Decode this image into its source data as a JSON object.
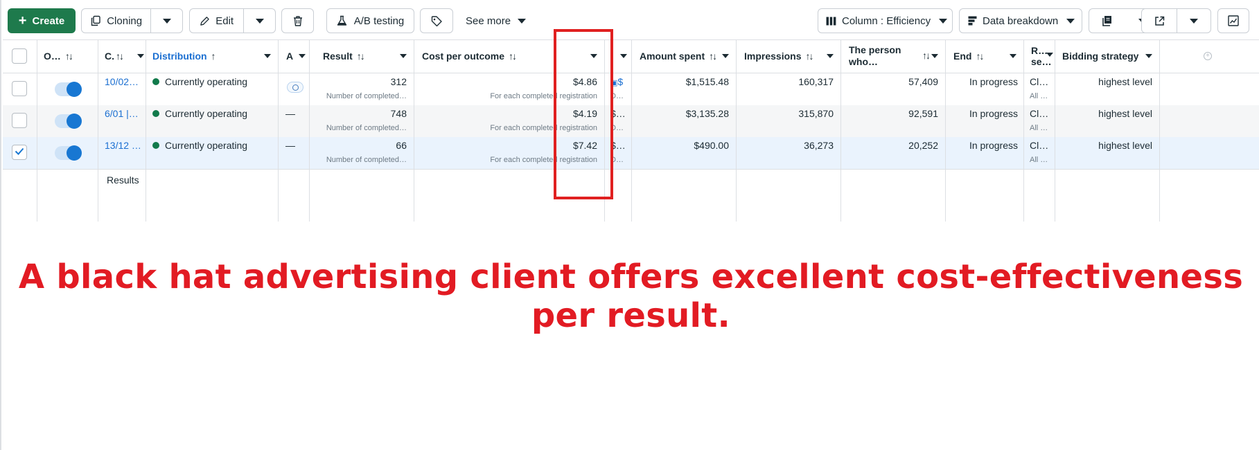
{
  "toolbar": {
    "create_label": "Create",
    "cloning_label": "Cloning",
    "edit_label": "Edit",
    "ab_testing_label": "A/B testing",
    "see_more_label": "See more",
    "column_label": "Column : Efficiency",
    "data_breakdown_label": "Data breakdown"
  },
  "columns": {
    "onoff": "O…",
    "campaign": "C.",
    "distribution": "Distribution",
    "a": "A",
    "result": "Result",
    "cost_per_outcome": "Cost per outcome",
    "amount_spent": "Amount spent",
    "impressions": "Impressions",
    "person_line1": "The person",
    "person_line2": "who…",
    "end": "End",
    "r_line1": "R…",
    "r_line2": "se…",
    "bidding": "Bidding strategy"
  },
  "rows": [
    {
      "name": "10/02…",
      "status": "Currently operating",
      "a": "",
      "result": "312",
      "result_sub": "Number of completed…",
      "cost": "$4.86",
      "cost_sub": "For each completed registration",
      "mini": "$",
      "mini_sub": "D…",
      "amount": "$1,515.48",
      "impressions": "160,317",
      "reach": "57,409",
      "end": "In progress",
      "r": "Cl…",
      "r_sub": "All …",
      "bidding": "highest level",
      "checked": false
    },
    {
      "name": "6/01 |…",
      "status": "Currently operating",
      "a": "—",
      "result": "748",
      "result_sub": "Number of completed…",
      "cost": "$4.19",
      "cost_sub": "For each completed registration",
      "mini": "$…",
      "mini_sub": "D…",
      "amount": "$3,135.28",
      "impressions": "315,870",
      "reach": "92,591",
      "end": "In progress",
      "r": "Cl…",
      "r_sub": "All …",
      "bidding": "highest level",
      "checked": false
    },
    {
      "name": "13/12 …",
      "status": "Currently operating",
      "a": "—",
      "result": "66",
      "result_sub": "Number of completed…",
      "cost": "$7.42",
      "cost_sub": "For each completed registration",
      "mini": "$…",
      "mini_sub": "D…",
      "amount": "$490.00",
      "impressions": "36,273",
      "reach": "20,252",
      "end": "In progress",
      "r": "Cl…",
      "r_sub": "All …",
      "bidding": "highest level",
      "checked": true
    }
  ],
  "results_label": "Results",
  "banner_text": "A black hat advertising client offers excellent cost-effectiveness per result.",
  "colors": {
    "create_green": "#1e7a4c",
    "link_blue": "#1b6fd1",
    "status_green": "#117a4b",
    "annotation_red": "#e21b23",
    "selected_row": "#eaf3fd",
    "alt_row": "#f5f6f7"
  }
}
